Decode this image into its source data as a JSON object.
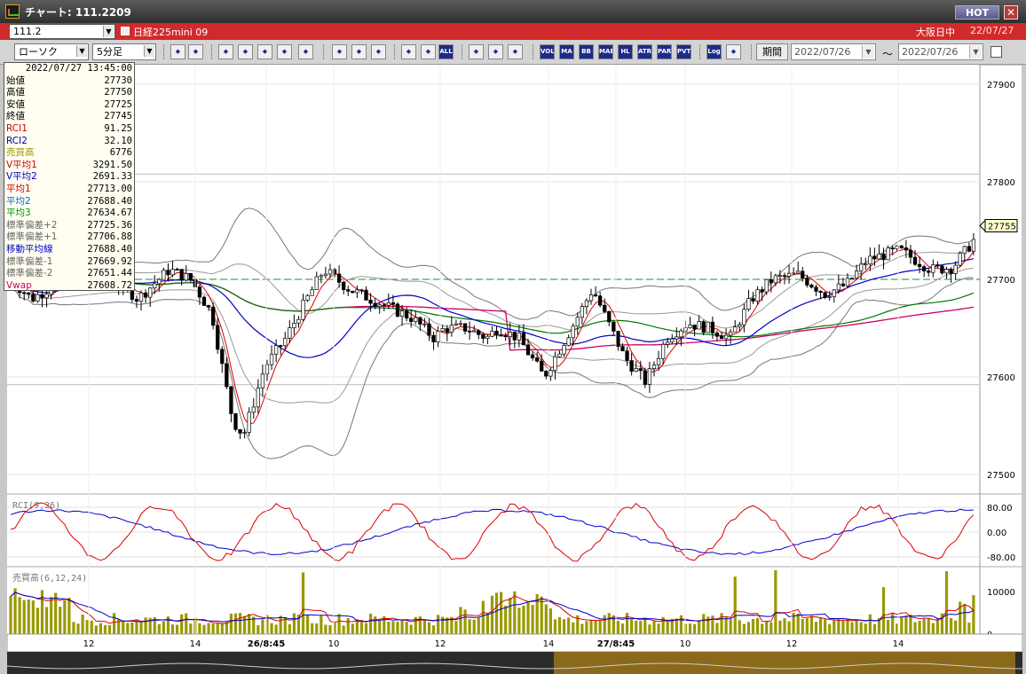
{
  "window": {
    "title": "チャート: 111.2209",
    "hot_label": "HOT",
    "close_label": "✕"
  },
  "symbol_bar": {
    "code": "111.2",
    "instrument": "日経225mini 09",
    "market": "大阪日中",
    "date": "22/07/27"
  },
  "toolbar": {
    "chart_type": "ローソク",
    "interval": "5分足",
    "buttons": [
      "zoom-icon",
      "cursor-icon",
      "cross-icon",
      "circle-icon",
      "bar-icon",
      "candle-switch-icon",
      "cut-icon",
      "pen-icon",
      "arrow-icon",
      "pointer-icon",
      "box-icon",
      "sort-icon",
      "ALL",
      "paint-icon",
      "wrench-icon",
      "color-icon",
      "VOL",
      "MA",
      "BB",
      "MAE",
      "HL",
      "ATR",
      "PAR",
      "PVT",
      "Log",
      "sheet-icon"
    ],
    "period_label": "期間",
    "date_from": "2022/07/26",
    "tilde": "〜",
    "date_to": "2022/07/26"
  },
  "info_panel": {
    "timestamp": "2022/07/27  13:45:00",
    "rows": [
      {
        "label": "始値",
        "value": "27730",
        "color": "#000000"
      },
      {
        "label": "高値",
        "value": "27750",
        "color": "#000000"
      },
      {
        "label": "安値",
        "value": "27725",
        "color": "#000000"
      },
      {
        "label": "終値",
        "value": "27745",
        "color": "#000000"
      },
      {
        "label": "RCI1",
        "value": "91.25",
        "color": "#cc0000"
      },
      {
        "label": "RCI2",
        "value": "32.10",
        "color": "#0000aa"
      },
      {
        "label": "売買高",
        "value": "6776",
        "color": "#999900"
      },
      {
        "label": "V平均1",
        "value": "3291.50",
        "color": "#cc0000"
      },
      {
        "label": "V平均2",
        "value": "2691.33",
        "color": "#0000cc"
      },
      {
        "label": "平均1",
        "value": "27713.00",
        "color": "#cc0000"
      },
      {
        "label": "平均2",
        "value": "27688.40",
        "color": "#0066cc"
      },
      {
        "label": "平均3",
        "value": "27634.67",
        "color": "#009900"
      },
      {
        "label": "標準偏差+2",
        "value": "27725.36",
        "color": "#666666"
      },
      {
        "label": "標準偏差+1",
        "value": "27706.88",
        "color": "#666666"
      },
      {
        "label": "移動平均線",
        "value": "27688.40",
        "color": "#0000cc"
      },
      {
        "label": "標準偏差-1",
        "value": "27669.92",
        "color": "#666666"
      },
      {
        "label": "標準偏差-2",
        "value": "27651.44",
        "color": "#666666"
      },
      {
        "label": "Vwap",
        "value": "27608.72",
        "color": "#cc0066"
      }
    ]
  },
  "chart_data": {
    "type": "candlestick",
    "price_axis": {
      "ticks": [
        "27900",
        "27800",
        "27700",
        "27600",
        "27500"
      ],
      "range": [
        27480,
        27920
      ]
    },
    "last_price_label": "27755",
    "reference_line": 27700,
    "rci_panel": {
      "label": "RCI(9,26)",
      "ticks": [
        "80.00",
        "0.00",
        "-80.00"
      ]
    },
    "volume_panel": {
      "label": "売買高(6,12,24)",
      "ticks": [
        "10000",
        "0"
      ],
      "max": 15000
    },
    "x_axis_labels": [
      "12",
      "14",
      "26/8:45",
      "10",
      "12",
      "14",
      "27/8:45",
      "10",
      "12",
      "14"
    ],
    "colors": {
      "up": "#ffffff",
      "down": "#000000",
      "ma1": "#dd0000",
      "ma2": "#0000cc",
      "ma3": "#007700",
      "vwap": "#cc0066",
      "bb": "#555555",
      "volume": "#999900"
    }
  }
}
